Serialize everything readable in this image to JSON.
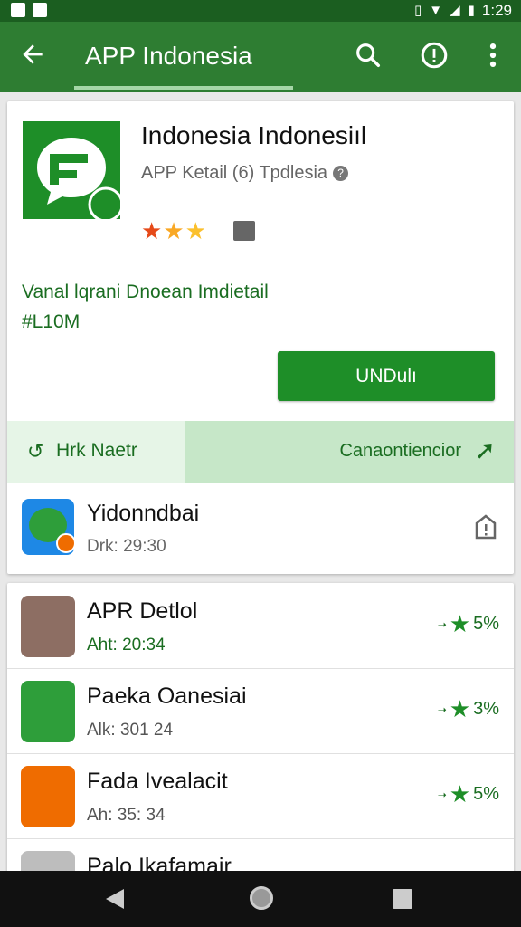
{
  "status_bar": {
    "time": "1:29"
  },
  "app_bar": {
    "title": "APP Indonesia"
  },
  "app": {
    "name": "Indonesia Indonesiıl",
    "subtitle": "APP Ketail (6) Tpdlesia",
    "description": "Vanal lqrani Dnoean Imdietail",
    "size": "#L10M",
    "install_label": "UNDulı"
  },
  "split_row": {
    "left_label": "Hrk Naetr",
    "right_label": "Canaontiencior"
  },
  "update_row": {
    "name": "Yidonndbai",
    "meta": "Drk: 29:30"
  },
  "list": [
    {
      "name": "APR Detlol",
      "meta": "Aht: 20:34",
      "rating": "5%"
    },
    {
      "name": "Paeka Oanesiai",
      "meta": "Alk: 301 24",
      "rating": "3%"
    },
    {
      "name": "Fada Ivealacit",
      "meta": "Ah: 35: 34",
      "rating": "5%"
    },
    {
      "name": "Palo Ikafamair",
      "meta": "",
      "rating": ""
    }
  ],
  "colors": {
    "primary": "#2e7d32",
    "status": "#1b5e20",
    "accent": "#1e8e28"
  }
}
